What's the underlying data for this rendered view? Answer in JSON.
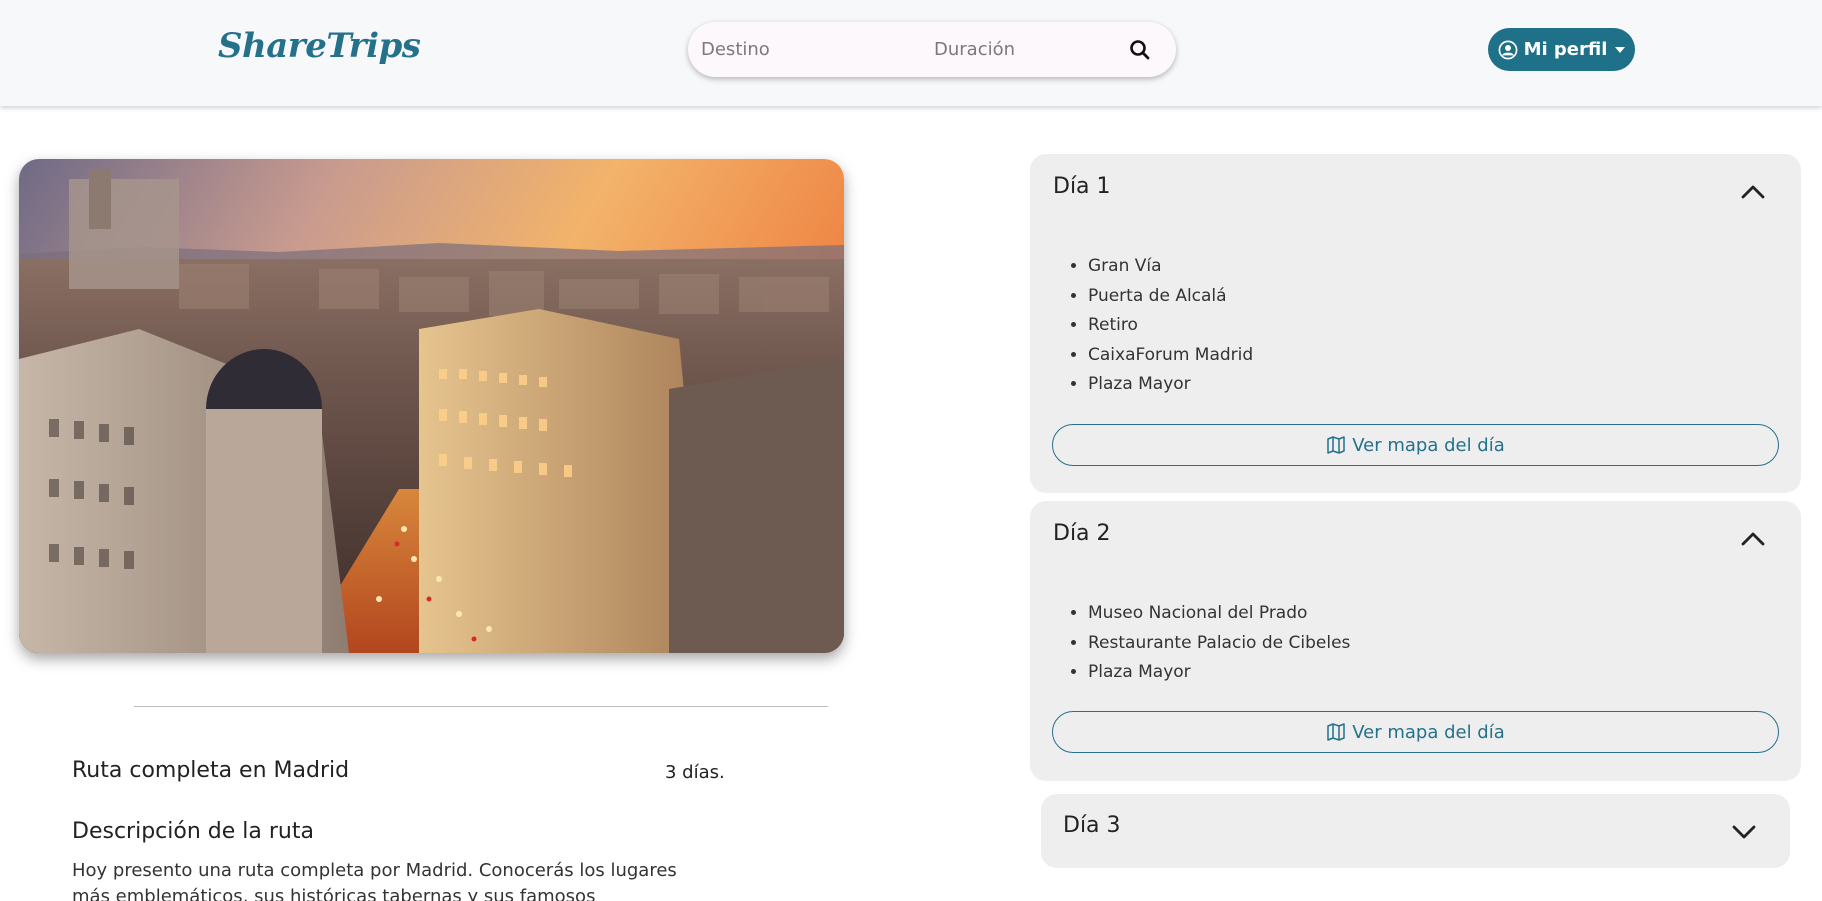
{
  "header": {
    "logo": "ShareTrips",
    "search": {
      "destination_placeholder": "Destino",
      "duration_placeholder": "Duración"
    },
    "profile_label": "Mi perfil"
  },
  "route": {
    "title": "Ruta completa en Madrid",
    "duration": "3 días.",
    "description_heading": "Descripción de la ruta",
    "description": "Hoy presento una ruta completa por Madrid. Conocerás los lugares más emblemáticos, sus históricas tabernas y sus famosos mercados"
  },
  "days": [
    {
      "title": "Día 1",
      "expanded": true,
      "places": [
        "Gran Vía",
        "Puerta de Alcalá",
        "Retiro",
        "CaixaForum Madrid",
        "Plaza Mayor"
      ],
      "map_button": "Ver mapa del día"
    },
    {
      "title": "Día 2",
      "expanded": true,
      "places": [
        "Museo Nacional del Prado",
        "Restaurante Palacio de Cibeles",
        "Plaza Mayor"
      ],
      "map_button": "Ver mapa del día"
    },
    {
      "title": "Día 3",
      "expanded": false
    }
  ],
  "colors": {
    "brand": "#1f7089",
    "card_bg": "#eeeeee",
    "header_bg": "#f7f8fa"
  },
  "icons": [
    "search-icon",
    "user-circle-icon",
    "caret-down-icon",
    "map-icon",
    "chevron-up-icon",
    "chevron-down-icon"
  ]
}
